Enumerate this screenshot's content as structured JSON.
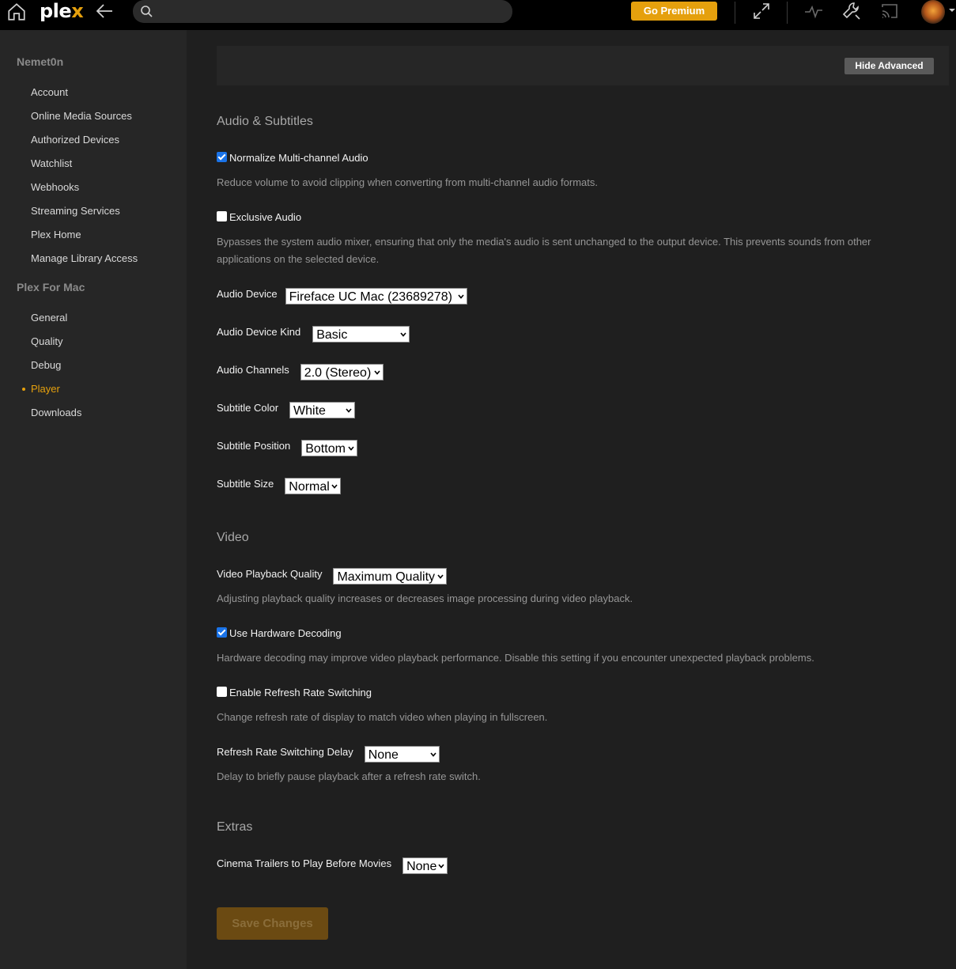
{
  "header": {
    "logo_main": "ple",
    "logo_x": "x",
    "search_placeholder": "",
    "premium_label": "Go Premium"
  },
  "sidebar": {
    "account_section": "Nemet0n",
    "account_items": [
      "Account",
      "Online Media Sources",
      "Authorized Devices",
      "Watchlist",
      "Webhooks",
      "Streaming Services",
      "Plex Home",
      "Manage Library Access"
    ],
    "app_section": "Plex For Mac",
    "app_items": [
      "General",
      "Quality",
      "Debug",
      "Player",
      "Downloads"
    ],
    "active_item": "Player"
  },
  "main": {
    "hide_advanced_label": "Hide Advanced",
    "audio_section": "Audio & Subtitles",
    "normalize_label": "Normalize Multi-channel Audio",
    "normalize_checked": true,
    "normalize_desc": "Reduce volume to avoid clipping when converting from multi-channel audio formats.",
    "exclusive_label": "Exclusive Audio",
    "exclusive_checked": false,
    "exclusive_desc": "Bypasses the system audio mixer, ensuring that only the media's audio is sent unchanged to the output device. This prevents sounds from other applications on the selected device.",
    "audio_device_label": "Audio Device",
    "audio_device_value": "Fireface UC Mac (23689278)",
    "audio_device_kind_label": "Audio Device Kind",
    "audio_device_kind_value": "Basic",
    "audio_channels_label": "Audio Channels",
    "audio_channels_value": "2.0 (Stereo)",
    "subtitle_color_label": "Subtitle Color",
    "subtitle_color_value": "White",
    "subtitle_position_label": "Subtitle Position",
    "subtitle_position_value": "Bottom",
    "subtitle_size_label": "Subtitle Size",
    "subtitle_size_value": "Normal",
    "video_section": "Video",
    "video_quality_label": "Video Playback Quality",
    "video_quality_value": "Maximum Quality",
    "video_quality_desc": "Adjusting playback quality increases or decreases image processing during video playback.",
    "hw_decoding_label": "Use Hardware Decoding",
    "hw_decoding_checked": true,
    "hw_decoding_desc": "Hardware decoding may improve video playback performance. Disable this setting if you encounter unexpected playback problems.",
    "refresh_switch_label": "Enable Refresh Rate Switching",
    "refresh_switch_checked": false,
    "refresh_switch_desc": "Change refresh rate of display to match video when playing in fullscreen.",
    "refresh_delay_label": "Refresh Rate Switching Delay",
    "refresh_delay_value": "None",
    "refresh_delay_desc": "Delay to briefly pause playback after a refresh rate switch.",
    "extras_section": "Extras",
    "trailers_label": "Cinema Trailers to Play Before Movies",
    "trailers_value": "None",
    "save_label": "Save Changes"
  },
  "colors": {
    "accent": "#e5a00d",
    "checkbox_on": "#1a73e8",
    "topbar_bg": "#000000",
    "sidebar_bg": "#262626",
    "main_bg": "#1f1f1f"
  }
}
